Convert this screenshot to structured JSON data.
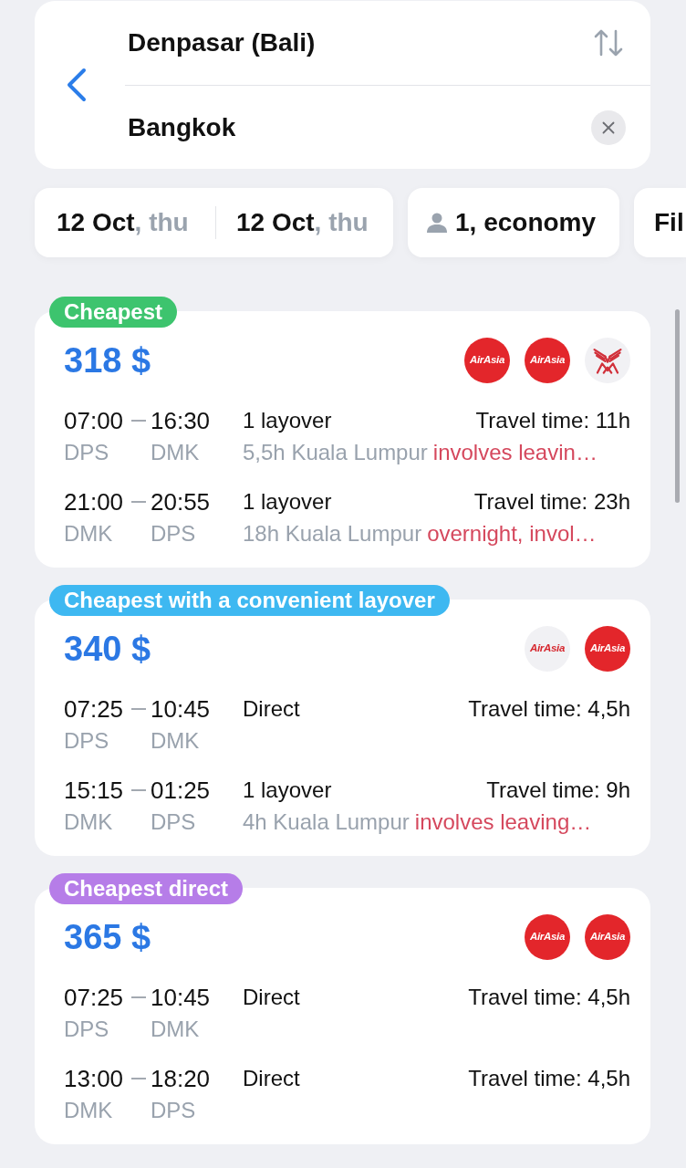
{
  "route": {
    "origin": "Denpasar (Bali)",
    "destination": "Bangkok"
  },
  "filters": {
    "dates": [
      {
        "date": "12 Oct",
        "weekday": ", thu"
      },
      {
        "date": "12 Oct",
        "weekday": ", thu"
      }
    ],
    "passengers": "1, economy",
    "more": "Fil"
  },
  "results": [
    {
      "badge": {
        "label": "Cheapest",
        "color": "#3dc46e"
      },
      "price": "318 $",
      "airlines": [
        {
          "kind": "wordmark",
          "text": "AirAsia",
          "filled": true
        },
        {
          "kind": "wordmark",
          "text": "AirAsia",
          "filled": true
        },
        {
          "kind": "emblem",
          "filled": false
        }
      ],
      "segments": [
        {
          "depart_time": "07:00",
          "arrive_time": "16:30",
          "depart_code": "DPS",
          "arrive_code": "DMK",
          "stops": "1 layover",
          "travel_time": "Travel time: 11h",
          "layover": "5,5h Kuala Lumpur",
          "warning": "involves leavin…"
        },
        {
          "depart_time": "21:00",
          "arrive_time": "20:55",
          "depart_code": "DMK",
          "arrive_code": "DPS",
          "stops": "1 layover",
          "travel_time": "Travel time: 23h",
          "layover": "18h Kuala Lumpur",
          "warning": "overnight, invol…"
        }
      ]
    },
    {
      "badge": {
        "label": "Cheapest with a convenient layover",
        "color": "#3eb8f1"
      },
      "price": "340 $",
      "airlines": [
        {
          "kind": "wordmark",
          "text": "AirAsia",
          "filled": false
        },
        {
          "kind": "wordmark",
          "text": "AirAsia",
          "filled": true
        }
      ],
      "segments": [
        {
          "depart_time": "07:25",
          "arrive_time": "10:45",
          "depart_code": "DPS",
          "arrive_code": "DMK",
          "stops": "Direct",
          "travel_time": "Travel time: 4,5h"
        },
        {
          "depart_time": "15:15",
          "arrive_time": "01:25",
          "depart_code": "DMK",
          "arrive_code": "DPS",
          "stops": "1 layover",
          "travel_time": "Travel time: 9h",
          "layover": "4h Kuala Lumpur",
          "warning": "involves leaving…"
        }
      ]
    },
    {
      "badge": {
        "label": "Cheapest direct",
        "color": "#b67de8"
      },
      "price": "365 $",
      "airlines": [
        {
          "kind": "wordmark",
          "text": "AirAsia",
          "filled": true
        },
        {
          "kind": "wordmark",
          "text": "AirAsia",
          "filled": true
        }
      ],
      "segments": [
        {
          "depart_time": "07:25",
          "arrive_time": "10:45",
          "depart_code": "DPS",
          "arrive_code": "DMK",
          "stops": "Direct",
          "travel_time": "Travel time: 4,5h"
        },
        {
          "depart_time": "13:00",
          "arrive_time": "18:20",
          "depart_code": "DMK",
          "arrive_code": "DPS",
          "stops": "Direct",
          "travel_time": "Travel time: 4,5h"
        }
      ]
    }
  ]
}
